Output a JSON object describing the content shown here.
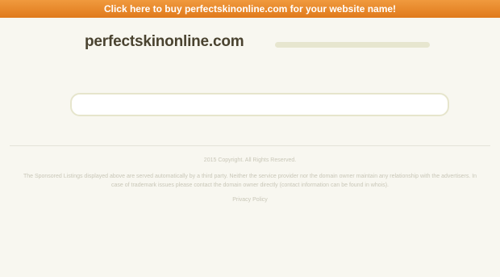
{
  "banner": {
    "text": "Click here to buy perfectskinonline.com for your website name!"
  },
  "header": {
    "domain": "perfectskinonline.com"
  },
  "search": {
    "top_value": "",
    "main_value": ""
  },
  "footer": {
    "copyright": "2015 Copyright. All Rights Reserved.",
    "disclaimer": "The Sponsored Listings displayed above are served automatically by a third party. Neither the service provider nor the domain owner maintain any relationship with the advertisers. In case of trademark issues please contact the domain owner directly (contact information can be found in whois).",
    "privacy_link": "Privacy Policy"
  },
  "colors": {
    "banner": "#e98a2c",
    "background": "#f8f7f0",
    "title": "#4a4330",
    "footer_text": "#c9c7b8"
  }
}
